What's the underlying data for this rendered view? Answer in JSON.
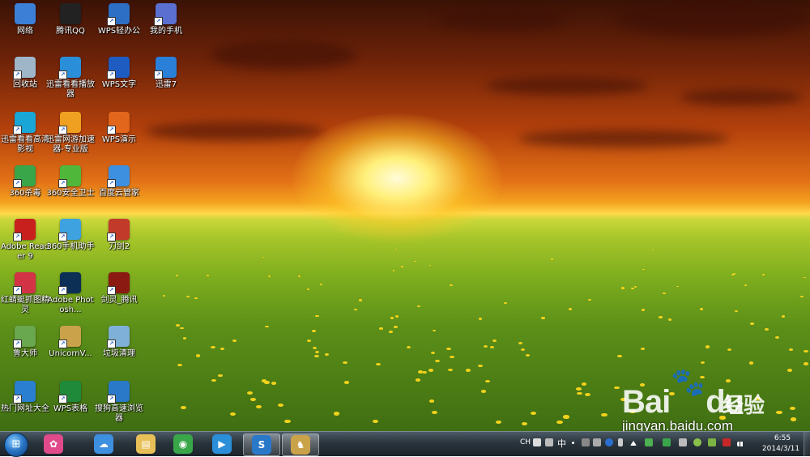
{
  "desktop": {
    "icons": [
      {
        "label": "网络",
        "icon": "network-icon",
        "color": "#3b7fd6"
      },
      {
        "label": "腾讯QQ",
        "icon": "qq-penguin-icon",
        "color": "#222222"
      },
      {
        "label": "WPS轻办公",
        "icon": "wps-light-office-icon",
        "color": "#2d6fc4"
      },
      {
        "label": "我的手机",
        "icon": "my-phone-icon",
        "color": "#5a6fd0"
      },
      {
        "label": "回收站",
        "icon": "recycle-bin-icon",
        "color": "#9fb6c9"
      },
      {
        "label": "迅雷看看播放器",
        "icon": "xunlei-kankan-player-icon",
        "color": "#2a8fd8"
      },
      {
        "label": "WPS文字",
        "icon": "wps-writer-icon",
        "color": "#1f5cc2"
      },
      {
        "label": "迅雷7",
        "icon": "xunlei7-icon",
        "color": "#2a7fd8"
      },
      {
        "label": "迅雷看看高清影视",
        "icon": "xunlei-kankan-hd-icon",
        "color": "#1aa6d6"
      },
      {
        "label": "迅雷网游加速器-专业版",
        "icon": "xunlei-game-accelerator-icon",
        "color": "#f0a020"
      },
      {
        "label": "WPS演示",
        "icon": "wps-presentation-icon",
        "color": "#e2661c"
      },
      {
        "label": "360杀毒",
        "icon": "360-antivirus-icon",
        "color": "#3aa64a"
      },
      {
        "label": "360安全卫士",
        "icon": "360-security-guard-icon",
        "color": "#4fb83a"
      },
      {
        "label": "百度云管家",
        "icon": "baidu-cloud-icon",
        "color": "#3d8fe0"
      },
      {
        "label": "Adobe Reader 9",
        "icon": "adobe-reader-icon",
        "color": "#c8201c"
      },
      {
        "label": "360手机助手",
        "icon": "360-phone-assistant-icon",
        "color": "#3fa2e0"
      },
      {
        "label": "刀剑2",
        "icon": "daojian2-game-icon",
        "color": "#c23a2a"
      },
      {
        "label": "红蜻蜓抓图精灵",
        "icon": "red-dragonfly-capture-icon",
        "color": "#d23446"
      },
      {
        "label": "Adobe Photosh...",
        "icon": "adobe-photoshop-icon",
        "color": "#0c2f55"
      },
      {
        "label": "剑灵_腾讯",
        "icon": "blade-soul-icon",
        "color": "#8a1a12"
      },
      {
        "label": "鲁大师",
        "icon": "ludashi-icon",
        "color": "#6aa84f"
      },
      {
        "label": "UnicornV...",
        "icon": "unicorn-icon",
        "color": "#caa24a"
      },
      {
        "label": "垃圾清理",
        "icon": "junk-cleanup-icon",
        "color": "#7fb0d8"
      },
      {
        "label": "热门网址大全",
        "icon": "popular-sites-icon",
        "color": "#2a7fd0"
      },
      {
        "label": "WPS表格",
        "icon": "wps-spreadsheet-icon",
        "color": "#1e8a3a"
      },
      {
        "label": "搜狗高速浏览器",
        "icon": "sogou-browser-icon",
        "color": "#2a78c8"
      }
    ]
  },
  "watermark": {
    "logo_text": "Bai",
    "logo_suffix": "du",
    "brand": "经验",
    "url": "jingyan.baidu.com"
  },
  "taskbar": {
    "start_icon": "windows-start-orb",
    "pinned": [
      {
        "name": "color-flower-app",
        "glyph": "✿",
        "color": "#e04a8a"
      },
      {
        "name": "baidu-cloud",
        "glyph": "☁",
        "color": "#3d8fe0"
      },
      {
        "name": "file-explorer",
        "glyph": "▤",
        "color": "#e8c058"
      },
      {
        "name": "360-browser",
        "glyph": "◉",
        "color": "#3aa64a"
      },
      {
        "name": "xunlei-kankan",
        "glyph": "▶",
        "color": "#2a8fd8"
      },
      {
        "name": "sogou-browser",
        "glyph": "S",
        "color": "#2a78c8"
      },
      {
        "name": "unicorn-game",
        "glyph": "♞",
        "color": "#caa24a"
      }
    ],
    "tray": {
      "lang": "CH",
      "ime": "中",
      "time": "6:55",
      "date": "2014/3/11"
    }
  }
}
